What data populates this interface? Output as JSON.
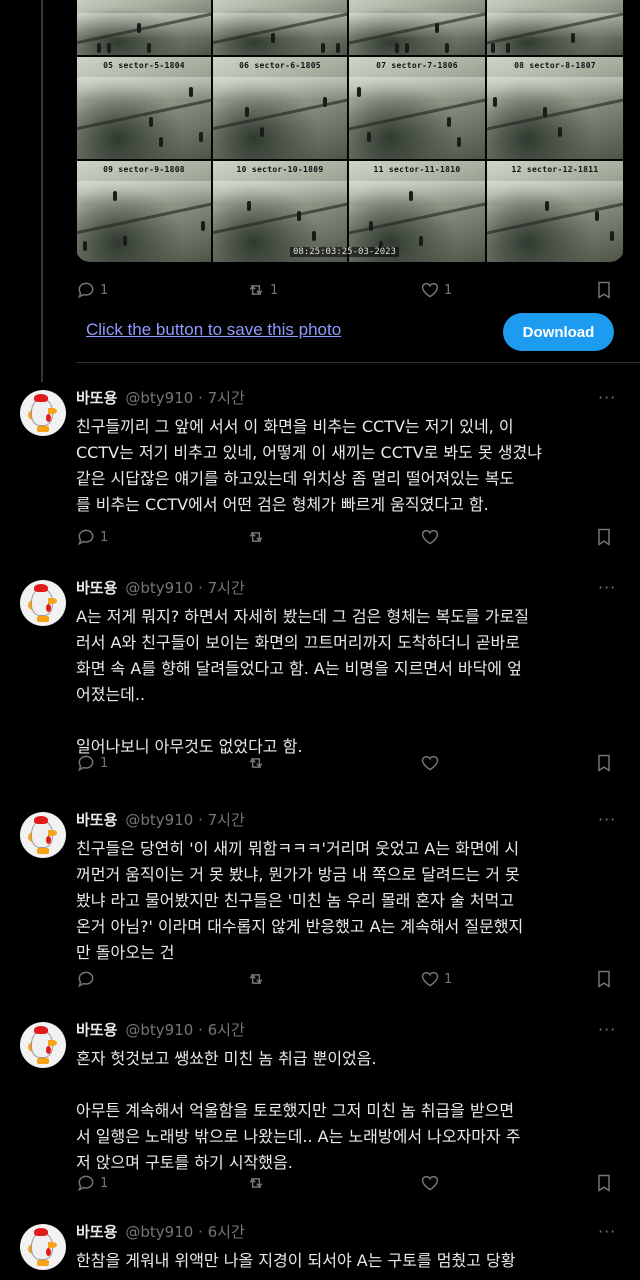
{
  "cctv": {
    "cells": [
      {
        "label": ""
      },
      {
        "label": ""
      },
      {
        "label": ""
      },
      {
        "label": ""
      },
      {
        "label": "05 sector-5-1804"
      },
      {
        "label": "06 sector-6-1805"
      },
      {
        "label": "07 sector-7-1806"
      },
      {
        "label": "08 sector-8-1807"
      },
      {
        "label": "09 sector-9-1808"
      },
      {
        "label": "10 sector-10-1809"
      },
      {
        "label": "11 sector-11-1810"
      },
      {
        "label": "12 sector-12-1811"
      }
    ],
    "timestamp": "08:25:03:25-03-2023"
  },
  "top_actions": {
    "replies": "1",
    "retweets": "1",
    "likes": "1"
  },
  "save_link": "Click the button to save this photo",
  "download_label": "Download",
  "tweets": [
    {
      "name": "바또용",
      "handle": "@bty910 · 7시간",
      "text": "친구들끼리 그 앞에 서서 이 화면을 비추는 CCTV는 저기 있네, 이\nCCTV는 저기 비추고 있네, 어떻게 이 새끼는 CCTV로 봐도 못 생겼냐\n같은 시답잖은 얘기를 하고있는데 위치상 좀 멀리 떨어져있는 복도\n를 비추는 CCTV에서 어떤 검은 형체가 빠르게 움직였다고 함.",
      "replies": "1",
      "retweets": "",
      "likes": ""
    },
    {
      "name": "바또용",
      "handle": "@bty910 · 7시간",
      "text": "A는 저게 뭐지? 하면서 자세히 봤는데 그 검은 형체는 복도를 가로질\n러서 A와 친구들이 보이는 화면의 끄트머리까지 도착하더니 곧바로\n화면 속 A를 향해 달려들었다고 함. A는 비명을 지르면서 바닥에 엎\n어졌는데..\n\n일어나보니 아무것도 없었다고 함.",
      "replies": "1",
      "retweets": "",
      "likes": ""
    },
    {
      "name": "바또용",
      "handle": "@bty910 · 7시간",
      "text": "친구들은 당연히 '이 새끼 뭐함ㅋㅋㅋ'거리며 웃었고 A는 화면에 시\n꺼먼거 움직이는 거 못 봤냐, 뭔가가 방금 내 쪽으로 달려드는 거 못\n봤냐 라고 물어봤지만 친구들은 '미친 놈 우리 몰래 혼자 술 처먹고\n온거 아님?' 이라며 대수롭지 않게 반응했고 A는 계속해서 질문했지\n만 돌아오는 건",
      "replies": "",
      "retweets": "",
      "likes": "1"
    },
    {
      "name": "바또용",
      "handle": "@bty910 · 6시간",
      "text": "혼자 헛것보고 쌩쑈한 미친 놈 취급 뿐이었음.\n\n아무튼 계속해서 억울함을 토로했지만 그저 미친 놈 취급을 받으면\n서 일행은 노래방 밖으로 나왔는데.. A는 노래방에서 나오자마자 주\n저 앉으며 구토를 하기 시작했음.",
      "replies": "1",
      "retweets": "",
      "likes": ""
    },
    {
      "name": "바또용",
      "handle": "@bty910 · 6시간",
      "text": "한참을 게워내 위액만 나올 지경이 되서야 A는 구토를 멈췄고 당황",
      "replies": "",
      "retweets": "",
      "likes": ""
    }
  ]
}
